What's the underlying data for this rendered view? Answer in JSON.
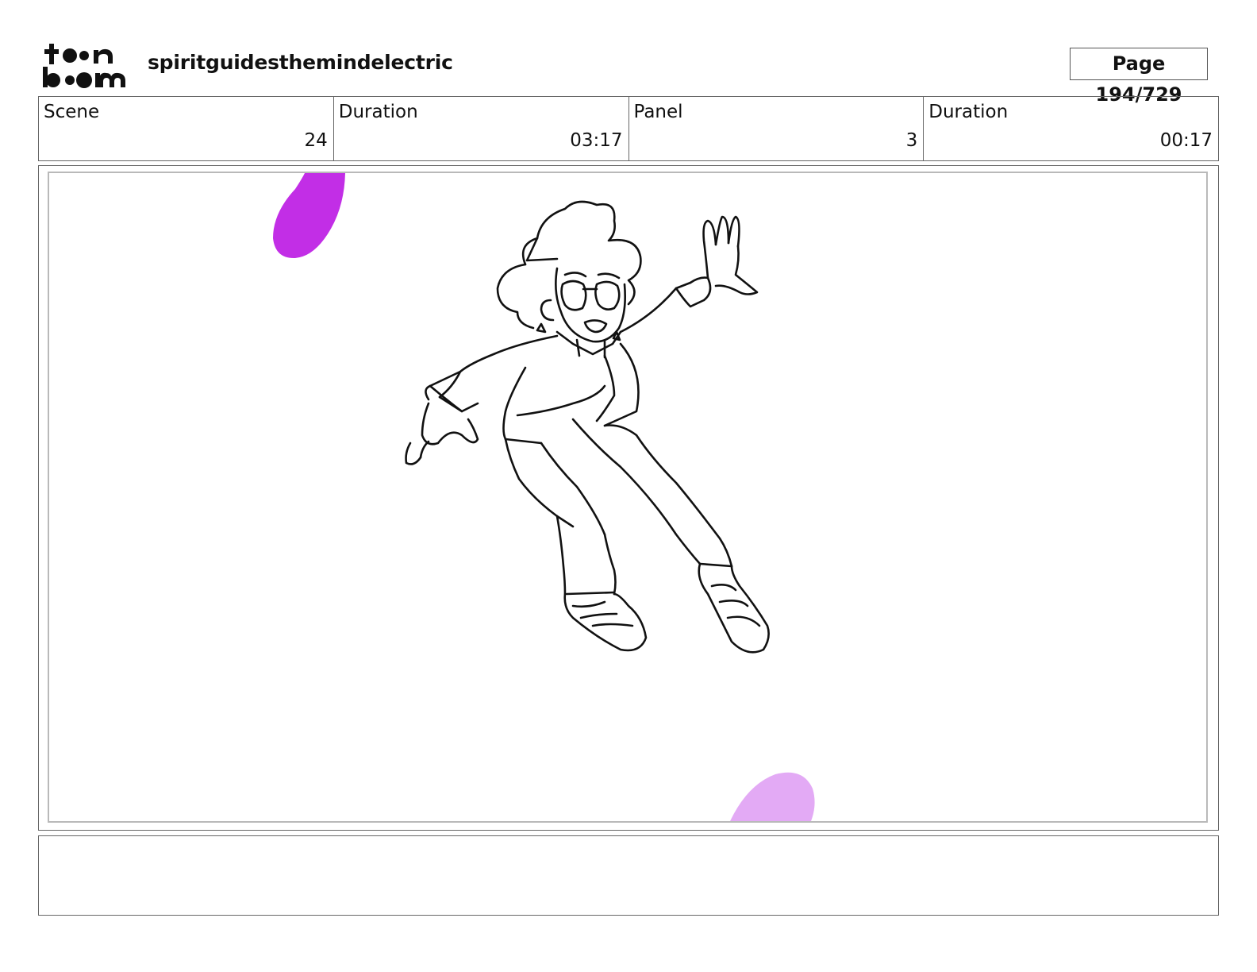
{
  "header": {
    "logo_text": "toon boom",
    "project_title": "spiritguidesthemindelectric",
    "page_indicator": "Page 194/729"
  },
  "info": {
    "scene_label": "Scene",
    "scene_value": "24",
    "scene_duration_label": "Duration",
    "scene_duration_value": "03:17",
    "panel_label": "Panel",
    "panel_value": "3",
    "panel_duration_label": "Duration",
    "panel_duration_value": "00:17"
  },
  "colors": {
    "magenta_shape": "#c22ee6",
    "light_magenta_shape": "#e3aaf5",
    "line_art": "#111111"
  },
  "notes": {
    "text": ""
  }
}
